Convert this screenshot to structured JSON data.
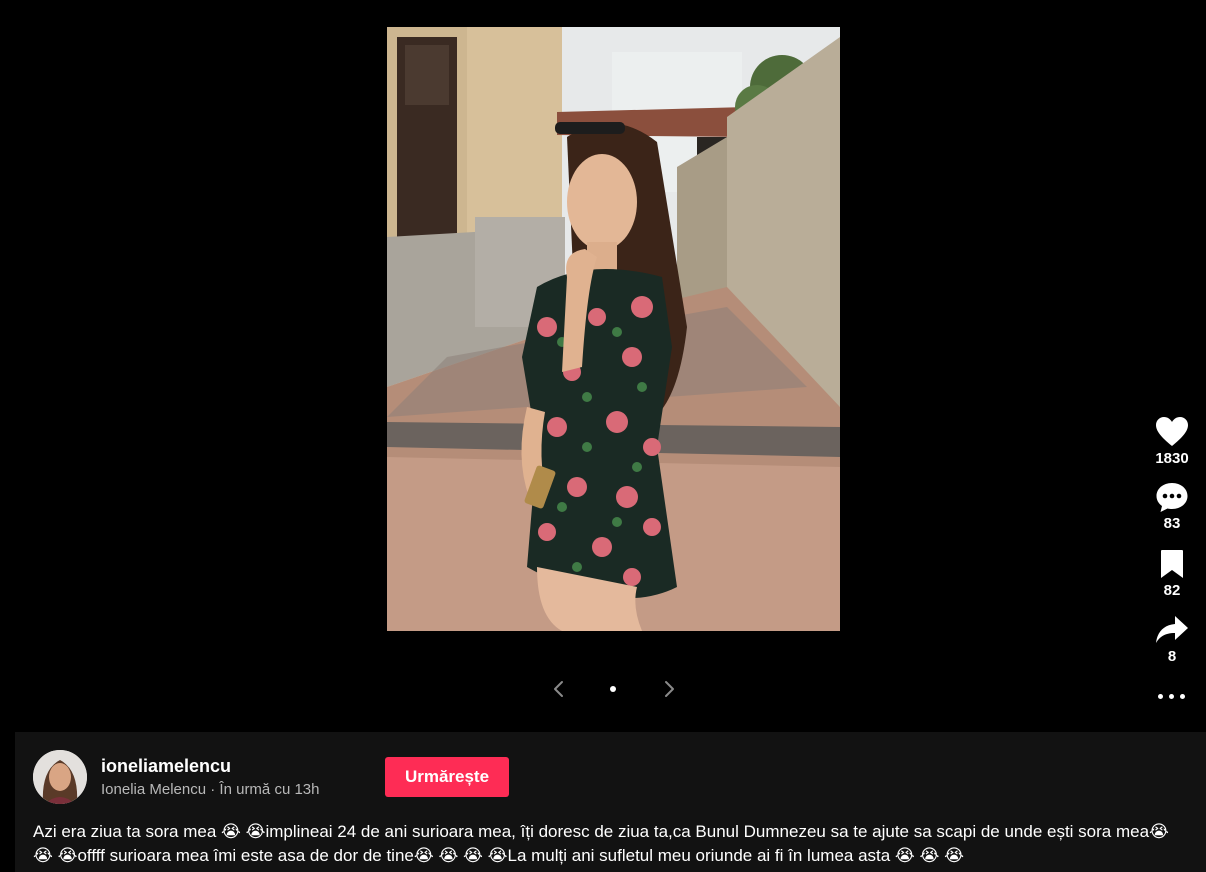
{
  "post": {
    "likes": "1830",
    "comments": "83",
    "saves": "82",
    "shares": "8"
  },
  "author": {
    "username": "ioneliamelencu",
    "display_name": "Ionelia Melencu",
    "separator": " · ",
    "time_ago": "În urmă cu 13h",
    "follow_label": "Urmărește"
  },
  "caption": "Azi era ziua ta sora mea 😭 😭implineai 24 de ani surioara mea, îți doresc de ziua ta,ca Bunul Dumnezeu sa te ajute sa scapi de unde ești sora mea😭 😭 😭offff surioara mea îmi este asa de dor de tine😭 😭 😭 😭La mulți ani sufletul meu oriunde ai fi în lumea asta 😭 😭 😭",
  "colors": {
    "background": "#000000",
    "panel": "#121212",
    "accent": "#fe2c55",
    "muted_text": "#b8b8b8"
  },
  "icons": [
    "heart-icon",
    "comment-icon",
    "bookmark-icon",
    "share-icon",
    "more-icon",
    "chevron-left-icon",
    "chevron-right-icon"
  ],
  "carousel": {
    "current_slide": 1,
    "total_slides": 1
  }
}
